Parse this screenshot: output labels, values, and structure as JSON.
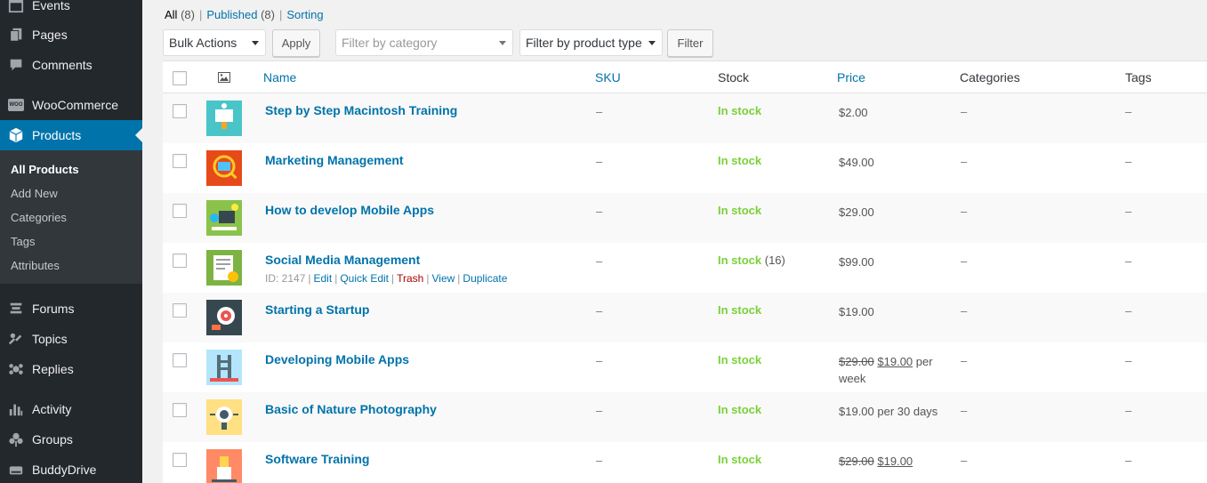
{
  "sidebar": {
    "events": "Events",
    "pages": "Pages",
    "comments": "Comments",
    "woocommerce": "WooCommerce",
    "woo_badge": "WOO",
    "products": "Products",
    "submenu": [
      "All Products",
      "Add New",
      "Categories",
      "Tags",
      "Attributes"
    ],
    "forums": "Forums",
    "topics": "Topics",
    "replies": "Replies",
    "activity": "Activity",
    "groups": "Groups",
    "buddydrive": "BuddyDrive"
  },
  "views": {
    "all_label": "All",
    "all_count": "(8)",
    "published_label": "Published",
    "published_count": "(8)",
    "sorting_label": "Sorting",
    "separator": "|"
  },
  "toolbar": {
    "bulk_actions": "Bulk Actions",
    "apply": "Apply",
    "category_placeholder": "Filter by category",
    "product_type": "Filter by product type",
    "filter": "Filter"
  },
  "columns": {
    "name": "Name",
    "sku": "SKU",
    "stock": "Stock",
    "price": "Price",
    "categories": "Categories",
    "tags": "Tags"
  },
  "products": [
    {
      "name": "Step by Step Macintosh Training",
      "sku": "–",
      "stock": "In stock",
      "price": "$2.00",
      "categories": "–",
      "tags": "–"
    },
    {
      "name": "Marketing Management",
      "sku": "–",
      "stock": "In stock",
      "price": "$49.00",
      "categories": "–",
      "tags": "–"
    },
    {
      "name": "How to develop Mobile Apps",
      "sku": "–",
      "stock": "In stock",
      "price": "$29.00",
      "categories": "–",
      "tags": "–"
    },
    {
      "name": "Social Media Management",
      "sku": "–",
      "stock": "In stock",
      "stock_qty": "(16)",
      "price": "$99.00",
      "categories": "–",
      "tags": "–",
      "row_actions": {
        "id": "ID: 2147",
        "edit": "Edit",
        "quick_edit": "Quick Edit",
        "trash": "Trash",
        "view": "View",
        "duplicate": "Duplicate",
        "sep": "|"
      }
    },
    {
      "name": "Starting a Startup",
      "sku": "–",
      "stock": "In stock",
      "price": "$19.00",
      "categories": "–",
      "tags": "–"
    },
    {
      "name": "Developing Mobile Apps",
      "sku": "–",
      "stock": "In stock",
      "price_old": "$29.00",
      "price_new": "$19.00",
      "price_suffix": "per week",
      "categories": "–",
      "tags": "–"
    },
    {
      "name": "Basic of Nature Photography",
      "sku": "–",
      "stock": "In stock",
      "price": "$19.00 per 30 days",
      "categories": "–",
      "tags": "–"
    },
    {
      "name": "Software Training",
      "sku": "–",
      "stock": "In stock",
      "price_old": "$29.00",
      "price_new": "$19.00",
      "categories": "–",
      "tags": "–"
    }
  ],
  "colors": {
    "sidebar_bg": "#23282d",
    "active_bg": "#0073aa",
    "link": "#0073aa",
    "in_stock": "#7ad03a",
    "trash": "#aa0000"
  }
}
